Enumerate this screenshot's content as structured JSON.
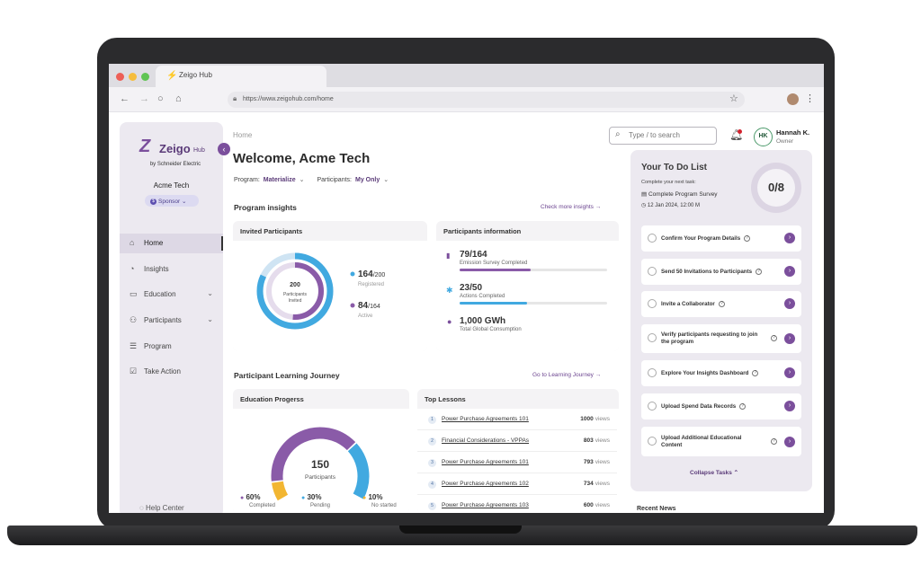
{
  "browser": {
    "tab_title": "Zeigo Hub",
    "url": "https://www.zeigohub.com/home"
  },
  "brand": {
    "name": "Zeigo",
    "hub": "Hub",
    "byline": "by Schneider Electric"
  },
  "org": {
    "company": "Acme Tech",
    "role_badge": "Sponsor"
  },
  "sidebar": {
    "items": [
      {
        "label": "Home",
        "icon": "home-icon"
      },
      {
        "label": "Insights",
        "icon": "insights-icon"
      },
      {
        "label": "Education",
        "icon": "book-icon"
      },
      {
        "label": "Participants",
        "icon": "people-icon"
      },
      {
        "label": "Program",
        "icon": "list-icon"
      },
      {
        "label": "Take Action",
        "icon": "checklist-icon"
      }
    ],
    "help": "Help Center"
  },
  "header": {
    "breadcrumb": "Home",
    "title": "Welcome, Acme Tech",
    "program_label": "Program:",
    "program_value": "Materialize",
    "participants_label": "Participants:",
    "participants_value": "My Only",
    "search_placeholder": "Type / to search",
    "user_initials": "HK",
    "user_name": "Hannah K.",
    "user_role": "Owner"
  },
  "insights": {
    "title": "Program insights",
    "link": "Check more insights",
    "invited": {
      "title": "Invited Participants",
      "center_value": "200",
      "center_label_1": "Participants",
      "center_label_2": "Invited",
      "registered_value": "164",
      "registered_total": "/200",
      "registered_label": "Registered",
      "active_value": "84",
      "active_total": "/164",
      "active_label": "Active",
      "colors": {
        "registered": "#41a9e0",
        "active": "#8a5ba8",
        "track": "#cfe4f3"
      }
    },
    "participants_info": {
      "title": "Participants information",
      "rows": [
        {
          "value": "79/164",
          "label": "Emission Survey Completed",
          "progress": 0.48,
          "color": "#8a5ba8",
          "icon": "clipboard-icon"
        },
        {
          "value": "23/50",
          "label": "Actions Completed",
          "progress": 0.46,
          "color": "#41a9e0",
          "icon": "puzzle-icon"
        },
        {
          "value": "1,000 GWh",
          "label": "Total Global Consumption",
          "icon": "bulb-icon"
        }
      ]
    }
  },
  "journey": {
    "title": "Participant Learning Journey",
    "link": "Go to Learning Journey",
    "education": {
      "title": "Education Progerss",
      "center_value": "150",
      "center_label": "Participants",
      "legend": [
        {
          "value": "60%",
          "label": "Completed",
          "color": "#8a5ba8",
          "fraction": 0.6
        },
        {
          "value": "30%",
          "label": "Pending",
          "color": "#41a9e0",
          "fraction": 0.3
        },
        {
          "value": "10%",
          "label": "No started",
          "color": "#f2b632",
          "fraction": 0.1
        }
      ]
    },
    "lessons": {
      "title": "Top Lessons",
      "views_label": "views",
      "items": [
        {
          "num": "1",
          "title": "Power Purchase Agreements 101",
          "views": "1000"
        },
        {
          "num": "2",
          "title": "Financial Considerations - VPPAs",
          "views": "803"
        },
        {
          "num": "3",
          "title": "Power Purchase Agreements 101",
          "views": "793"
        },
        {
          "num": "4",
          "title": "Power Purchase Agreements 102",
          "views": "734"
        },
        {
          "num": "5",
          "title": "Power Purchase Agreements 103",
          "views": "600"
        }
      ]
    }
  },
  "todo": {
    "title": "Your To Do List",
    "subtitle": "Complete your next task:",
    "next_task": "Complete Program Survey",
    "next_date": "12 Jan 2024, 12:00 M",
    "score": "0/8",
    "tasks": [
      "Confirm Your Program Details",
      "Send 50 Invitations to Participants",
      "Invite a Collaborator",
      "Verify participants requesting to join the program",
      "Explore Your Insights Dashboard",
      "Upload Spend Data Records",
      "Upload Additional Educational Content"
    ],
    "collapse": "Collapse Tasks",
    "recent": "Recent News"
  }
}
